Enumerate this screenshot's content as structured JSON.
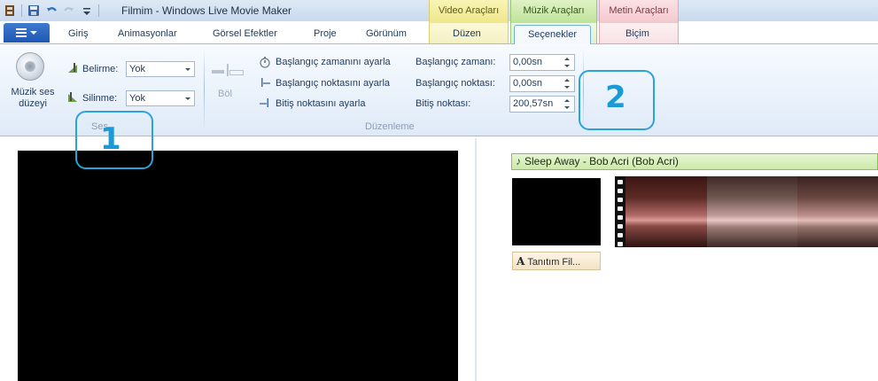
{
  "window": {
    "title": "Filmim - Windows Live Movie Maker"
  },
  "context_tabs": {
    "video": "Video Araçları",
    "muzik": "Müzik Araçları",
    "metin": "Metin Araçları"
  },
  "tabs": {
    "giris": "Giriş",
    "animasyonlar": "Animasyonlar",
    "gorsel_efektler": "Görsel Efektler",
    "proje": "Proje",
    "gorunum": "Görünüm",
    "duzen": "Düzen",
    "secenekler": "Seçenekler",
    "bicim": "Biçim"
  },
  "ribbon": {
    "ses": {
      "label": "Ses",
      "muzik_ses_duzeyi": "Müzik ses düzeyi",
      "belirme_label": "Belirme:",
      "belirme_value": "Yok",
      "silinme_label": "Silinme:",
      "silinme_value": "Yok"
    },
    "duzenleme": {
      "label": "Düzenleme",
      "bol": "Böl",
      "baslangic_zamani_ayarla": "Başlangıç zamanını ayarla",
      "baslangic_noktasi_ayarla": "Başlangıç noktasını ayarla",
      "bitis_noktasi_ayarla": "Bitiş noktasını ayarla",
      "baslangic_zamani_label": "Başlangıç zamanı:",
      "baslangic_zamani_value": "0,00sn",
      "baslangic_noktasi_label": "Başlangıç noktası:",
      "baslangic_noktasi_value": "0,00sn",
      "bitis_noktasi_label": "Bitiş noktası:",
      "bitis_noktasi_value": "200,57sn"
    }
  },
  "callouts": {
    "one": "1",
    "two": "2"
  },
  "storyboard": {
    "music_title": "Sleep Away - Bob Acri (Bob Acri)",
    "caption": "Tanıtım Fil..."
  },
  "colors": {
    "accent": "#2aa3d8",
    "ctx_video": "#efe78b",
    "ctx_muzik": "#bfe39a",
    "ctx_metin": "#f3c8cd",
    "music_bar": "#cbe9a9"
  }
}
